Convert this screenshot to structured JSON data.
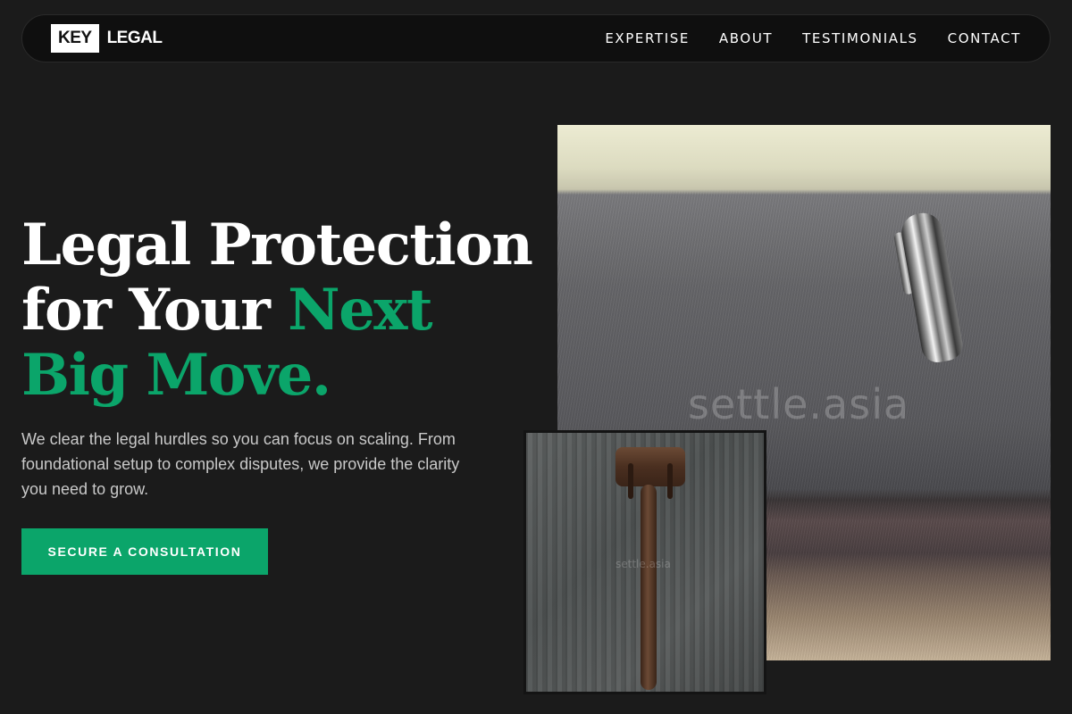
{
  "brand": {
    "key": "KEY",
    "name": "LEGAL"
  },
  "nav": {
    "items": [
      {
        "label": "EXPERTISE"
      },
      {
        "label": "ABOUT"
      },
      {
        "label": "TESTIMONIALS"
      },
      {
        "label": "CONTACT"
      }
    ]
  },
  "hero": {
    "headline_line1": "Legal Protection",
    "headline_line2_plain": "for Your ",
    "headline_line2_accent": "Next",
    "headline_line3_accent": "Big Move.",
    "subtext": "We clear the legal hurdles so you can focus on scaling. From foundational setup to complex disputes, we provide the clarity you need to grow.",
    "cta_label": "SECURE A CONSULTATION"
  },
  "images": {
    "pen_watermark": "settle.asia",
    "gavel_watermark": "settle.asia"
  },
  "colors": {
    "accent": "#0ba56a",
    "background": "#1b1b1b",
    "navbar": "#0f0f0f"
  },
  "icons": {
    "pen": "pen-photo",
    "gavel": "gavel-photo"
  }
}
